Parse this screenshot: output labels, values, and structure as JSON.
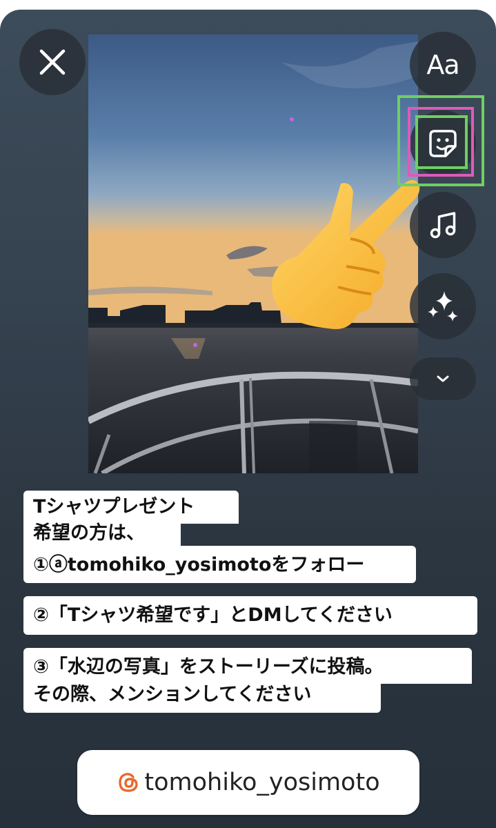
{
  "toolbar": {
    "close_icon": "close-icon",
    "text_button_label": "Aa",
    "sticker_icon": "sticker-icon",
    "music_icon": "music-note-icon",
    "effects_icon": "sparkles-icon",
    "more_icon": "chevron-down-icon"
  },
  "captions": {
    "block1_line1": "Tシャツプレゼント",
    "block1_line2": "希望の方は、",
    "block1_line3": "①ⓐtomohiko_yosimotoをフォロー",
    "block2_line1": "②「Tシャツ希望です」とDMしてください",
    "block3_line1": "③「水辺の写真」をストーリーズに投稿。",
    "block3_line2": "その際、メンションしてください"
  },
  "handle_sticker": {
    "icon": "threads-icon",
    "username": "tomohiko_yosimoto"
  },
  "colors": {
    "highlight_green": "#6fcf62",
    "highlight_pink": "#e05ab8",
    "threads_icon": "#e8692c"
  }
}
